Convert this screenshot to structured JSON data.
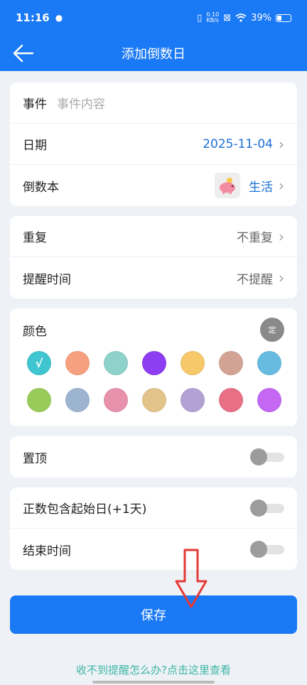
{
  "status": {
    "time": "11:16",
    "speed_value": "0.10",
    "speed_unit": "KB/s",
    "battery": "39%"
  },
  "header": {
    "title": "添加倒数日"
  },
  "event": {
    "label": "事件",
    "placeholder": "事件内容"
  },
  "date": {
    "label": "日期",
    "value": "2025-11-04"
  },
  "book": {
    "label": "倒数本",
    "value": "生活",
    "icon": "piggy-bank-icon"
  },
  "repeat": {
    "label": "重复",
    "value": "不重复"
  },
  "reminder": {
    "label": "提醒时间",
    "value": "不提醒"
  },
  "color": {
    "label": "颜色",
    "custom_label": "定",
    "selected_mark": "√",
    "selected_index": 0,
    "swatches": [
      "#3fc6d0",
      "#f7a07f",
      "#8fd1cb",
      "#8e3ef2",
      "#f6c86a",
      "#d2a395",
      "#67bbe0",
      "#98cc5a",
      "#9db4d0",
      "#e891ad",
      "#e2c48b",
      "#b3a1d6",
      "#e87086",
      "#c468f4"
    ]
  },
  "pin": {
    "label": "置顶",
    "on": false
  },
  "include_start": {
    "label": "正数包含起始日(+1天)",
    "on": false
  },
  "end_time": {
    "label": "结束时间",
    "on": false
  },
  "save": {
    "label": "保存"
  },
  "help": {
    "text": "收不到提醒怎么办?点击这里查看"
  },
  "colors": {
    "primary": "#1a79f5",
    "link": "#3fb5a6",
    "annotation_arrow": "#e53935"
  }
}
